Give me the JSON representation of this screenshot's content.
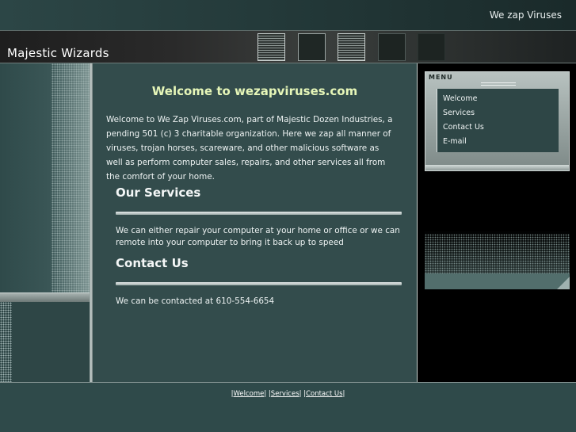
{
  "topbar": {
    "tagline": "We zap Viruses"
  },
  "header": {
    "site_title": "Majestic Wizards"
  },
  "main": {
    "welcome_heading": "Welcome to wezapviruses.com",
    "intro": "Welcome to We Zap Viruses.com, part of Majestic Dozen Industries, a pending 501 (c) 3 charitable organization. Here we zap all manner of viruses, trojan horses, scareware, and other malicious software as well as perform computer sales, repairs, and other services all from the comfort of your home.",
    "services_heading": "Our Services",
    "services_text": "We can either repair your computer at your home or office or we can remote into your computer to bring it back up to speed",
    "contact_heading": "Contact Us",
    "contact_text": "We can be contacted at 610-554-6654"
  },
  "menu": {
    "title": "MENU",
    "items": [
      "Welcome",
      "Services",
      "Contact Us",
      "E-mail"
    ]
  },
  "footer": {
    "links": [
      "Welcome",
      "Services",
      "Contact Us"
    ]
  }
}
